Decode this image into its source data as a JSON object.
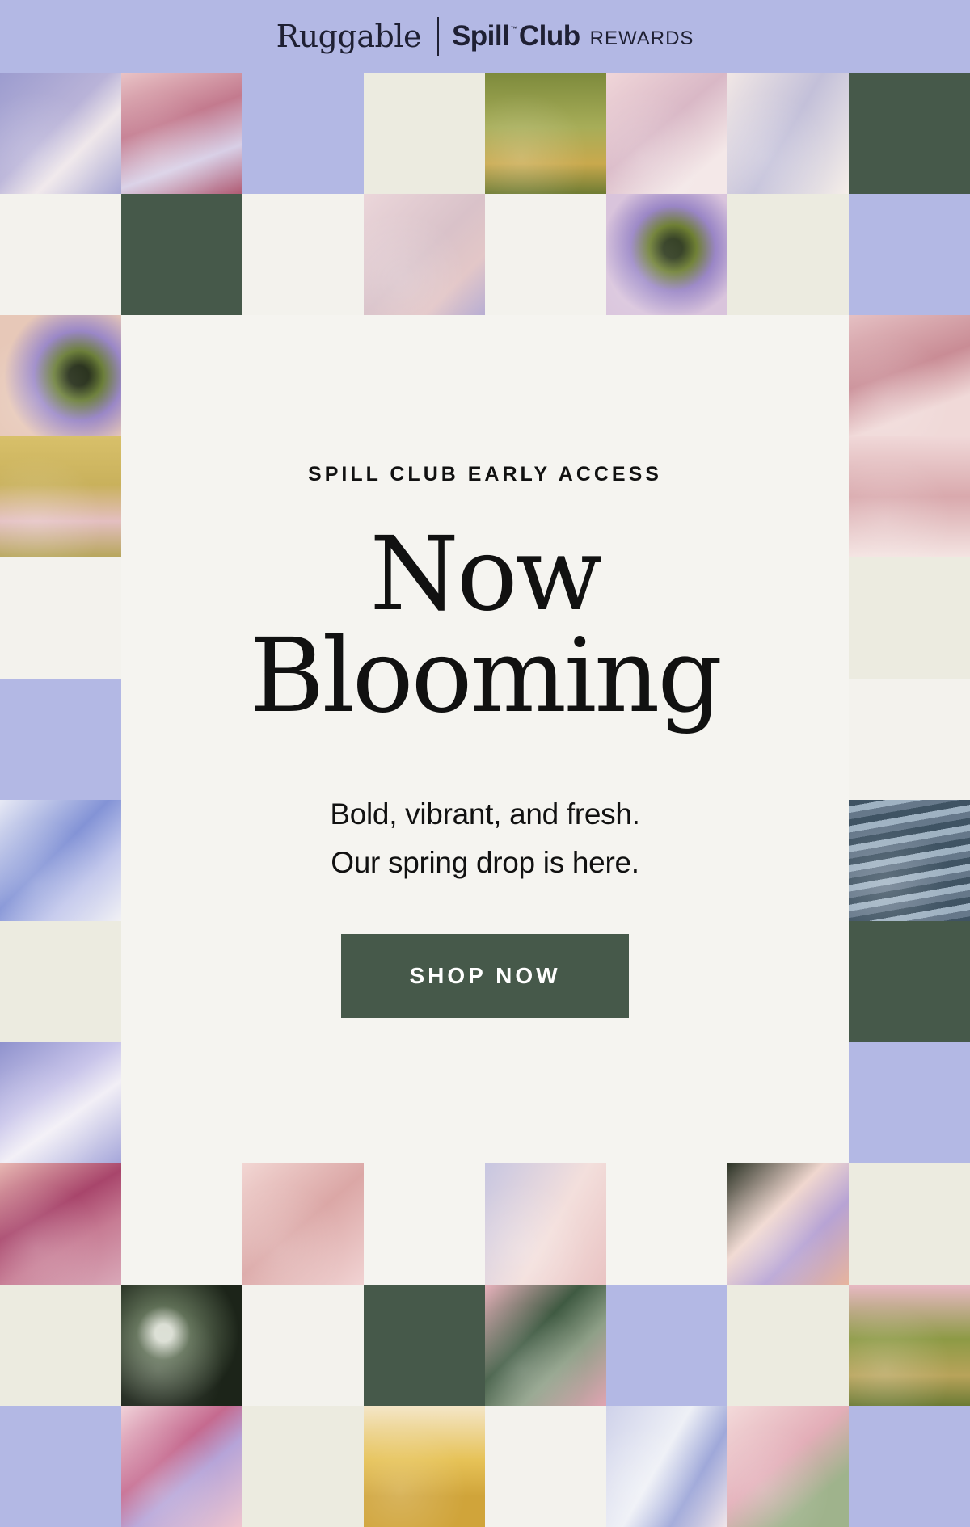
{
  "header": {
    "brand": "Ruggable",
    "program": "Spill",
    "trademark": "™",
    "program_suffix": "Club",
    "rewards": "REWARDS"
  },
  "hero": {
    "eyebrow": "SPILL CLUB EARLY ACCESS",
    "headline_line1": "Now",
    "headline_line2": "Blooming",
    "subhead_line1": "Bold, vibrant, and fresh.",
    "subhead_line2": "Our spring drop is here.",
    "cta_label": "SHOP NOW"
  },
  "colors": {
    "lavender": "#b3b8e4",
    "forest_green": "#46594a",
    "cream": "#ecebe0",
    "background": "#f5f4f0",
    "text": "#111111"
  },
  "tiles": [
    {
      "name": "floral-tile",
      "style": "linear-gradient(135deg,#9c9ccf,#b9b3d8 45%,#efe7ea 65%,#a8a7d4)",
      "style_class": "t-img"
    },
    {
      "name": "floral-tile",
      "style": "linear-gradient(160deg,#e9c3c6,#c37a8e 40%,#d8cfe6 70%,#b05a72)",
      "style_class": "t-img"
    },
    {
      "name": "lavender-tile",
      "style_class": "t-lav"
    },
    {
      "name": "cream-tile",
      "style_class": "t-cream"
    },
    {
      "name": "meadow-photo-tile",
      "style": "linear-gradient(180deg,#7d8a3c,#a7ad58 45%,#c9a94d 75%,#6f7c33)",
      "style_class": "t-img"
    },
    {
      "name": "floral-tile",
      "style": "linear-gradient(140deg,#f0d6d9,#d9b8c6 45%,#f4e8e8 80%)",
      "style_class": "t-img"
    },
    {
      "name": "floral-tile",
      "style": "linear-gradient(120deg,#f1e7e5,#c3c0d9 50%,#f6efe9)",
      "style_class": "t-img"
    },
    {
      "name": "green-tile",
      "style_class": "t-green"
    },
    {
      "name": "offwhite-tile",
      "style_class": "t-offwhite"
    },
    {
      "name": "green-tile",
      "style_class": "t-green"
    },
    {
      "name": "offwhite-tile",
      "style_class": "t-offwhite"
    },
    {
      "name": "floral-tile",
      "style": "linear-gradient(135deg,#ebd6da,#d9c2c9 50%,#e3c7c8 75%,#b8aed3)",
      "style_class": "t-img"
    },
    {
      "name": "offwhite-tile",
      "style_class": "t-offwhite"
    },
    {
      "name": "floral-tile",
      "style": "radial-gradient(circle at 55% 45%,#2f3b1f 10%,#6e7f33 25%,#9a86c6 45%,#d9c4dc 75%)",
      "style_class": "t-img"
    },
    {
      "name": "cream-tile",
      "style_class": "t-cream"
    },
    {
      "name": "lavender-tile",
      "style_class": "t-lav"
    },
    {
      "name": "floral-tile",
      "style": "radial-gradient(circle at 65% 50%,#27301b 10%,#6c7f3a 25%,#9a87c7 45%,#e7c8b8 75%)",
      "style_class": "t-img"
    },
    {
      "name": "floral-tile",
      "style": "linear-gradient(160deg,#e5c0c3,#c98c95 45%,#f0d9d8 75%)",
      "style_class": "t-img"
    },
    {
      "name": "meadow-photo-tile",
      "style": "linear-gradient(180deg,#d8c06a,#c9b15c 40%,#e4bfc1 70%,#b7a65a)",
      "style_class": "t-img"
    },
    {
      "name": "floral-tile",
      "style": "linear-gradient(180deg,#f0d8d8,#d9a9ad 50%,#f4e4e2)",
      "style_class": "t-img"
    },
    {
      "name": "offwhite-tile",
      "style_class": "t-offwhite"
    },
    {
      "name": "cream-tile",
      "style_class": "t-cream"
    },
    {
      "name": "lavender-tile",
      "style_class": "t-lav"
    },
    {
      "name": "offwhite-tile",
      "style_class": "t-offwhite"
    },
    {
      "name": "floral-tile",
      "style": "linear-gradient(135deg,#e8eaf5,#8393d6 45%,#c3c8ec 70%,#f1f1f5)",
      "style_class": "t-img"
    },
    {
      "name": "striped-textile-tile",
      "style": "repeating-linear-gradient(170deg,#3f5363 0 8px,#9fb2c2 8px 16px,#66788a 16px 24px)",
      "style_class": "t-img"
    },
    {
      "name": "cream-tile",
      "style_class": "t-cream"
    },
    {
      "name": "green-tile",
      "style_class": "t-green"
    },
    {
      "name": "floral-tile",
      "style": "linear-gradient(145deg,#8f92cd,#c9c5ea 40%,#f2eff6 60%,#a5a6da)",
      "style_class": "t-img"
    },
    {
      "name": "lavender-tile",
      "style_class": "t-lav"
    },
    {
      "name": "floral-tile",
      "style": "linear-gradient(150deg,#e7b7b2,#a8456b 40%,#c77c94 65%,#d9a8b8)",
      "style_class": "t-img"
    },
    {
      "name": "floral-tile",
      "style": "linear-gradient(140deg,#f2d6d3,#dba7a6 50%,#f1d3d3)",
      "style_class": "t-img"
    },
    {
      "name": "floral-tile",
      "style": "linear-gradient(120deg,#c7c6e1,#f3dfdc 55%,#e9c3c3)",
      "style_class": "t-img"
    },
    {
      "name": "floral-tile",
      "style": "linear-gradient(135deg,#2d3427,#f0d7cf 40%,#b7a3d4 65%,#e7b49d)",
      "style_class": "t-img"
    },
    {
      "name": "cream-tile",
      "style_class": "t-cream"
    },
    {
      "name": "cream-tile",
      "style_class": "t-cream"
    },
    {
      "name": "bokeh-photo-tile",
      "style": "radial-gradient(circle at 35% 40%,#d9ddd2 8%,#5f6f56 25%,#1c2419 70%)",
      "style_class": "t-img"
    },
    {
      "name": "offwhite-tile",
      "style_class": "t-offwhite"
    },
    {
      "name": "green-tile",
      "style_class": "t-green"
    },
    {
      "name": "leaf-photo-tile",
      "style": "linear-gradient(135deg,#e9b3bd,#3f5a42 40%,#8fa088 65%,#e0a4b2)",
      "style_class": "t-img"
    },
    {
      "name": "lavender-tile",
      "style_class": "t-lav"
    },
    {
      "name": "cream-tile",
      "style_class": "t-cream"
    },
    {
      "name": "meadow-photo-tile",
      "style": "linear-gradient(180deg,#e8b9c4,#8d9a45 45%,#b8a35a 75%,#6c7b35)",
      "style_class": "t-img"
    },
    {
      "name": "lavender-tile",
      "style_class": "t-lav"
    },
    {
      "name": "floral-tile",
      "style": "linear-gradient(140deg,#f1d3da,#c56a8f 40%,#b6a4d8 60%,#efc6cf)",
      "style_class": "t-img"
    },
    {
      "name": "cream-tile",
      "style_class": "t-cream"
    },
    {
      "name": "meadow-photo-tile",
      "style": "linear-gradient(180deg,#f4e6c8,#e6c257 45%,#d0a43a 75%)",
      "style_class": "t-img"
    },
    {
      "name": "offwhite-tile",
      "style_class": "t-offwhite"
    },
    {
      "name": "floral-tile",
      "style": "linear-gradient(120deg,#cfd2ea,#eef0f6 45%,#9fa8d9 70%,#f1e6ea)",
      "style_class": "t-img"
    },
    {
      "name": "floral-tile",
      "style": "linear-gradient(140deg,#f3dada,#e3aeb8 45%,#9fb38c 75%)",
      "style_class": "t-img"
    },
    {
      "name": "lavender-tile",
      "style_class": "t-lav"
    }
  ]
}
